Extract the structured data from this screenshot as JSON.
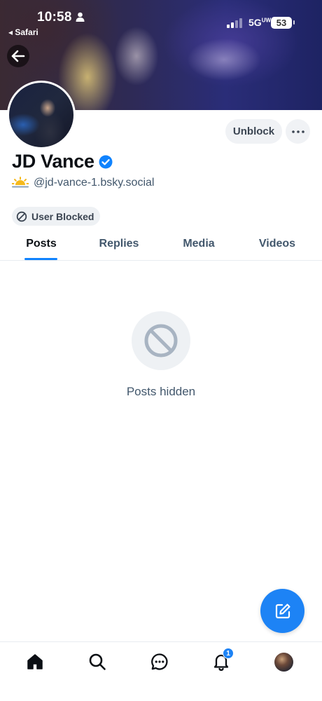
{
  "status_bar": {
    "time": "10:58",
    "back_app": "◂ Safari",
    "network": "5G",
    "network_sub": "UW",
    "battery": "53"
  },
  "profile": {
    "display_name": "JD Vance",
    "handle": "@jd-vance-1.bsky.social",
    "verified": true,
    "blocked_label": "User Blocked"
  },
  "actions": {
    "unblock_label": "Unblock"
  },
  "tabs": [
    {
      "label": "Posts",
      "active": true
    },
    {
      "label": "Replies",
      "active": false
    },
    {
      "label": "Media",
      "active": false
    },
    {
      "label": "Videos",
      "active": false
    }
  ],
  "empty_state": {
    "message": "Posts hidden",
    "icon": "ban-icon"
  },
  "bottom_nav": {
    "items": [
      "home-icon",
      "search-icon",
      "chat-icon",
      "bell-icon",
      "profile-avatar"
    ],
    "notification_count": "1"
  },
  "colors": {
    "accent": "#1083fe",
    "fab": "#1d83f5",
    "muted_text": "#42576c",
    "pill_bg": "#f0f2f5"
  }
}
